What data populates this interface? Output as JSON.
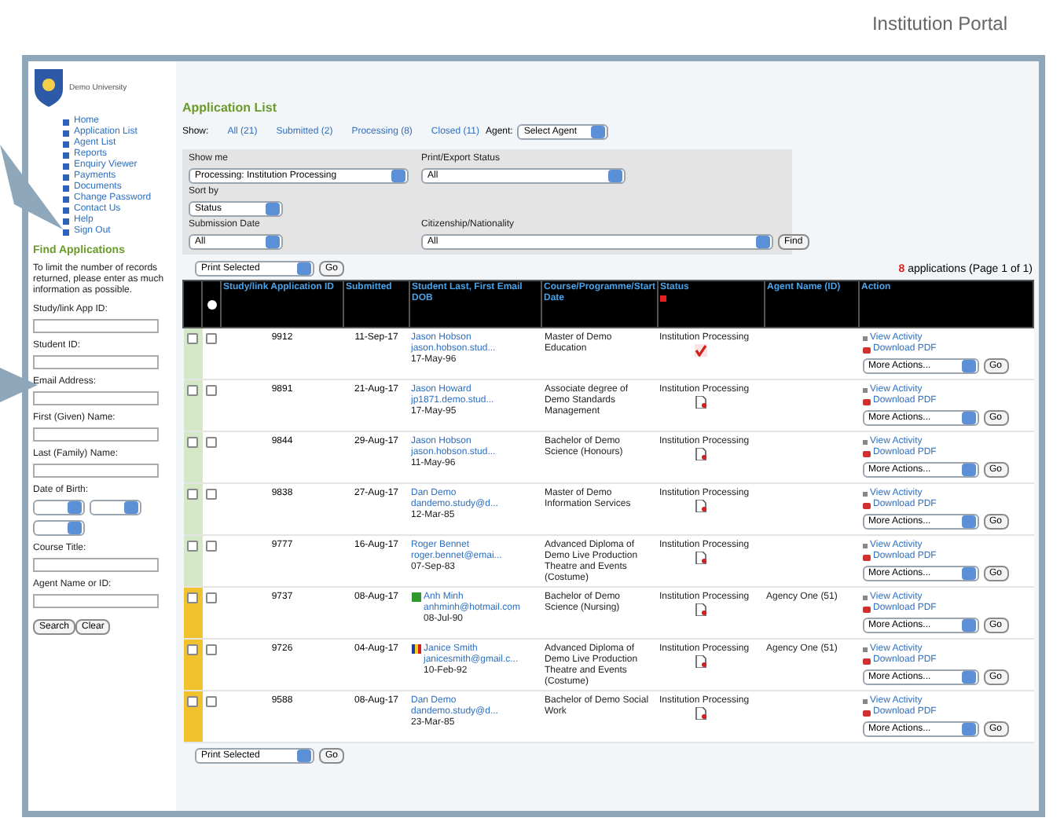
{
  "caption": "Institution Portal",
  "sidebar": {
    "logo_text": "Demo University",
    "nav": [
      "Home",
      "Application List",
      "Agent List",
      "Reports",
      "Enquiry Viewer",
      "Payments",
      "Documents",
      "Change Password",
      "Contact Us",
      "Help",
      "Sign Out"
    ],
    "find": {
      "title": "Find Applications",
      "hint": "To limit the number of records returned, please enter as much information as possible.",
      "fields": [
        {
          "label": "Study/link App ID:",
          "kind": "text"
        },
        {
          "label": "Student ID:",
          "kind": "text"
        },
        {
          "label": "Email Address:",
          "kind": "text"
        },
        {
          "label": "First (Given) Name:",
          "kind": "text"
        },
        {
          "label": "Last (Family) Name:",
          "kind": "text"
        },
        {
          "label": "Date of Birth:",
          "kind": "date"
        },
        {
          "label": "Course Title:",
          "kind": "text"
        },
        {
          "label": "Agent Name or ID:",
          "kind": "text"
        }
      ],
      "buttons": [
        "Search",
        "Clear"
      ]
    }
  },
  "main": {
    "title": "Application List",
    "show_label": "Show:",
    "show_links": [
      "All (21)",
      "Submitted (2)",
      "Processing (8)",
      "Closed (11)"
    ],
    "agent_label": "Agent:",
    "agent_select": "Select Agent",
    "filters": [
      {
        "label": "Show me",
        "value": "Processing: Institution Processing"
      },
      {
        "label": "Print/Export Status",
        "value": "All"
      },
      {
        "label": "Sort by",
        "value": "Status"
      },
      {
        "label": "Submission Date",
        "value": "All"
      },
      {
        "label": "Citizenship/Nationality",
        "value": "All"
      }
    ],
    "find_button": "Find",
    "bulk_top": {
      "select": "Print Selected",
      "button": "Go"
    },
    "count": {
      "number": "8",
      "text": "applications (Page 1 of 1)"
    },
    "table": {
      "columns": [
        "Study/link Application ID",
        "Submitted",
        "Student Last, First Email DOB",
        "Course/Programme/Start Date",
        "Status",
        "Agent Name (ID)",
        "Action"
      ],
      "rows": [
        {
          "color": "#d4e8c8",
          "checked": false,
          "id": "9912",
          "submitted": "11-Sep-17",
          "name": "Jason Hobson",
          "email": "jason.hobson.stud...",
          "dob": "17-May-96",
          "course": "Master of Demo Education",
          "status": "Institution Processing",
          "status_icon": {
            "kind": "tick"
          },
          "actions": [
            "View Activity",
            "Download PDF",
            "More Actions...",
            "Go"
          ]
        },
        {
          "color": "#d4e8c8",
          "checked": false,
          "id": "9891",
          "submitted": "21-Aug-17",
          "name": "Jason Howard",
          "email": "jp1871.demo.stud...",
          "dob": "17-May-95",
          "course": "Associate degree of Demo Standards Management",
          "status": "Institution Processing",
          "status_icon": {
            "kind": "document"
          },
          "actions": [
            "View Activity",
            "Download PDF",
            "More Actions...",
            "Go"
          ]
        },
        {
          "color": "#d4e8c8",
          "checked": false,
          "id": "9844",
          "submitted": "29-Aug-17",
          "name": "Jason Hobson",
          "email": "jason.hobson.stud...",
          "dob": "11-May-96",
          "course": "Bachelor of Demo Science (Honours)",
          "status": "Institution Processing",
          "status_icon": {
            "kind": "document"
          },
          "actions": [
            "View Activity",
            "Download PDF",
            "More Actions...",
            "Go"
          ]
        },
        {
          "color": "#d4e8c8",
          "checked": false,
          "id": "9838",
          "submitted": "27-Aug-17",
          "name": "Dan Demo",
          "email": "dandemo.study@d...",
          "dob": "12-Mar-85",
          "course": "Master of Demo Information Services",
          "status": "Institution Processing",
          "status_icon": {
            "kind": "document"
          },
          "actions": [
            "View Activity",
            "Download PDF",
            "More Actions...",
            "Go"
          ]
        },
        {
          "color": "#d4e8c8",
          "checked": false,
          "id": "9777",
          "submitted": "16-Aug-17",
          "name": "Roger Bennet",
          "email": "roger.bennet@emai...",
          "dob": "07-Sep-83",
          "course": "Advanced Diploma of Demo Live Production Theatre and Events (Costume)",
          "status": "Institution Processing",
          "status_icon": {
            "kind": "document"
          },
          "actions": [
            "View Activity",
            "Download PDF",
            "More Actions...",
            "Go"
          ]
        },
        {
          "color": "#f2c12e",
          "checked": false,
          "id": "9737",
          "submitted": "08-Aug-17",
          "flag": {
            "kind": "square"
          },
          "name": "Anh Minh",
          "email": "anhminh@hotmail.com",
          "dob": "08-Jul-90",
          "course": "Bachelor of Demo Science (Nursing)",
          "status": "Institution Processing",
          "status_icon": {
            "kind": "document"
          },
          "agent": "Agency One (51)",
          "actions": [
            "View Activity",
            "Download PDF",
            "More Actions...",
            "Go"
          ]
        },
        {
          "color": "#f2c12e",
          "checked": false,
          "id": "9726",
          "submitted": "04-Aug-17",
          "flag": {
            "kind": "stripes"
          },
          "name": "Janice Smith",
          "email": "janicesmith@gmail.c...",
          "dob": "10-Feb-92",
          "course": "Advanced Diploma of Demo Live Production Theatre and Events (Costume)",
          "status": "Institution Processing",
          "status_icon": {
            "kind": "document"
          },
          "agent": "Agency One (51)",
          "actions": [
            "View Activity",
            "Download PDF",
            "More Actions...",
            "Go"
          ]
        },
        {
          "color": "#f2c12e",
          "checked": false,
          "id": "9588",
          "submitted": "08-Aug-17",
          "name": "Dan Demo",
          "email": "dandemo.study@d...",
          "dob": "23-Mar-85",
          "course": "Bachelor of Demo Social Work",
          "status": "Institution Processing",
          "status_icon": {
            "kind": "document"
          },
          "actions": [
            "View Activity",
            "Download PDF",
            "More Actions...",
            "Go"
          ]
        }
      ]
    },
    "bulk_bottom": {
      "select": "Print Selected",
      "button": "Go"
    }
  }
}
